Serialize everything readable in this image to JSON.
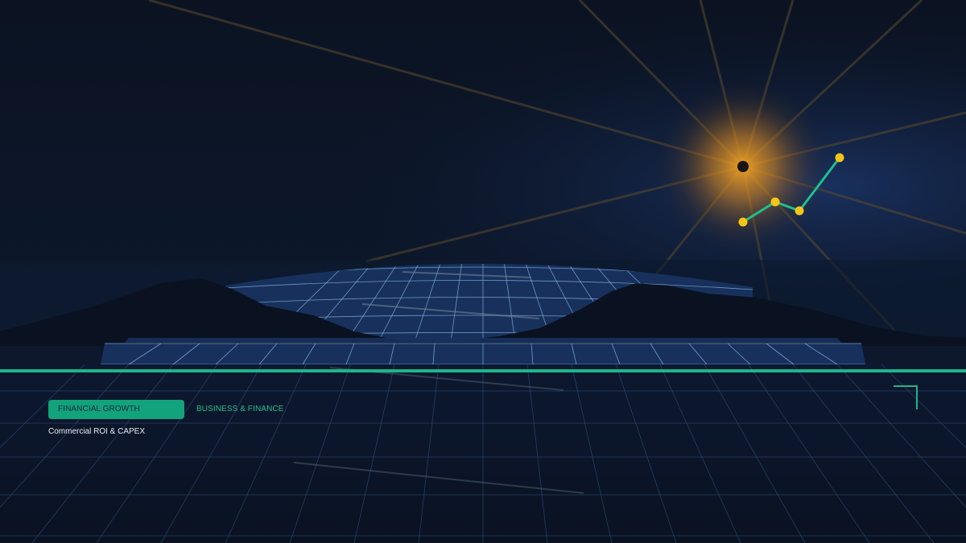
{
  "tags": {
    "primary": "FINANCIAL GROWTH",
    "secondary": "BUSINESS & FINANCE"
  },
  "subtitle": "Commercial ROI & CAPEX",
  "colors": {
    "sky_top": "#0b1322",
    "sky_glow": "#1a3266",
    "sun": "#f5a623",
    "trend_line": "#1fbf8e",
    "trend_points": "#f5c518",
    "grid_tiles": "#17315c",
    "grid_lines": "#8fb7e8",
    "horizon_line": "#1db689",
    "hills": "#0a1120"
  },
  "icons": {
    "trend": "growth-trend-icon",
    "corner": "frame-corner-icon"
  }
}
